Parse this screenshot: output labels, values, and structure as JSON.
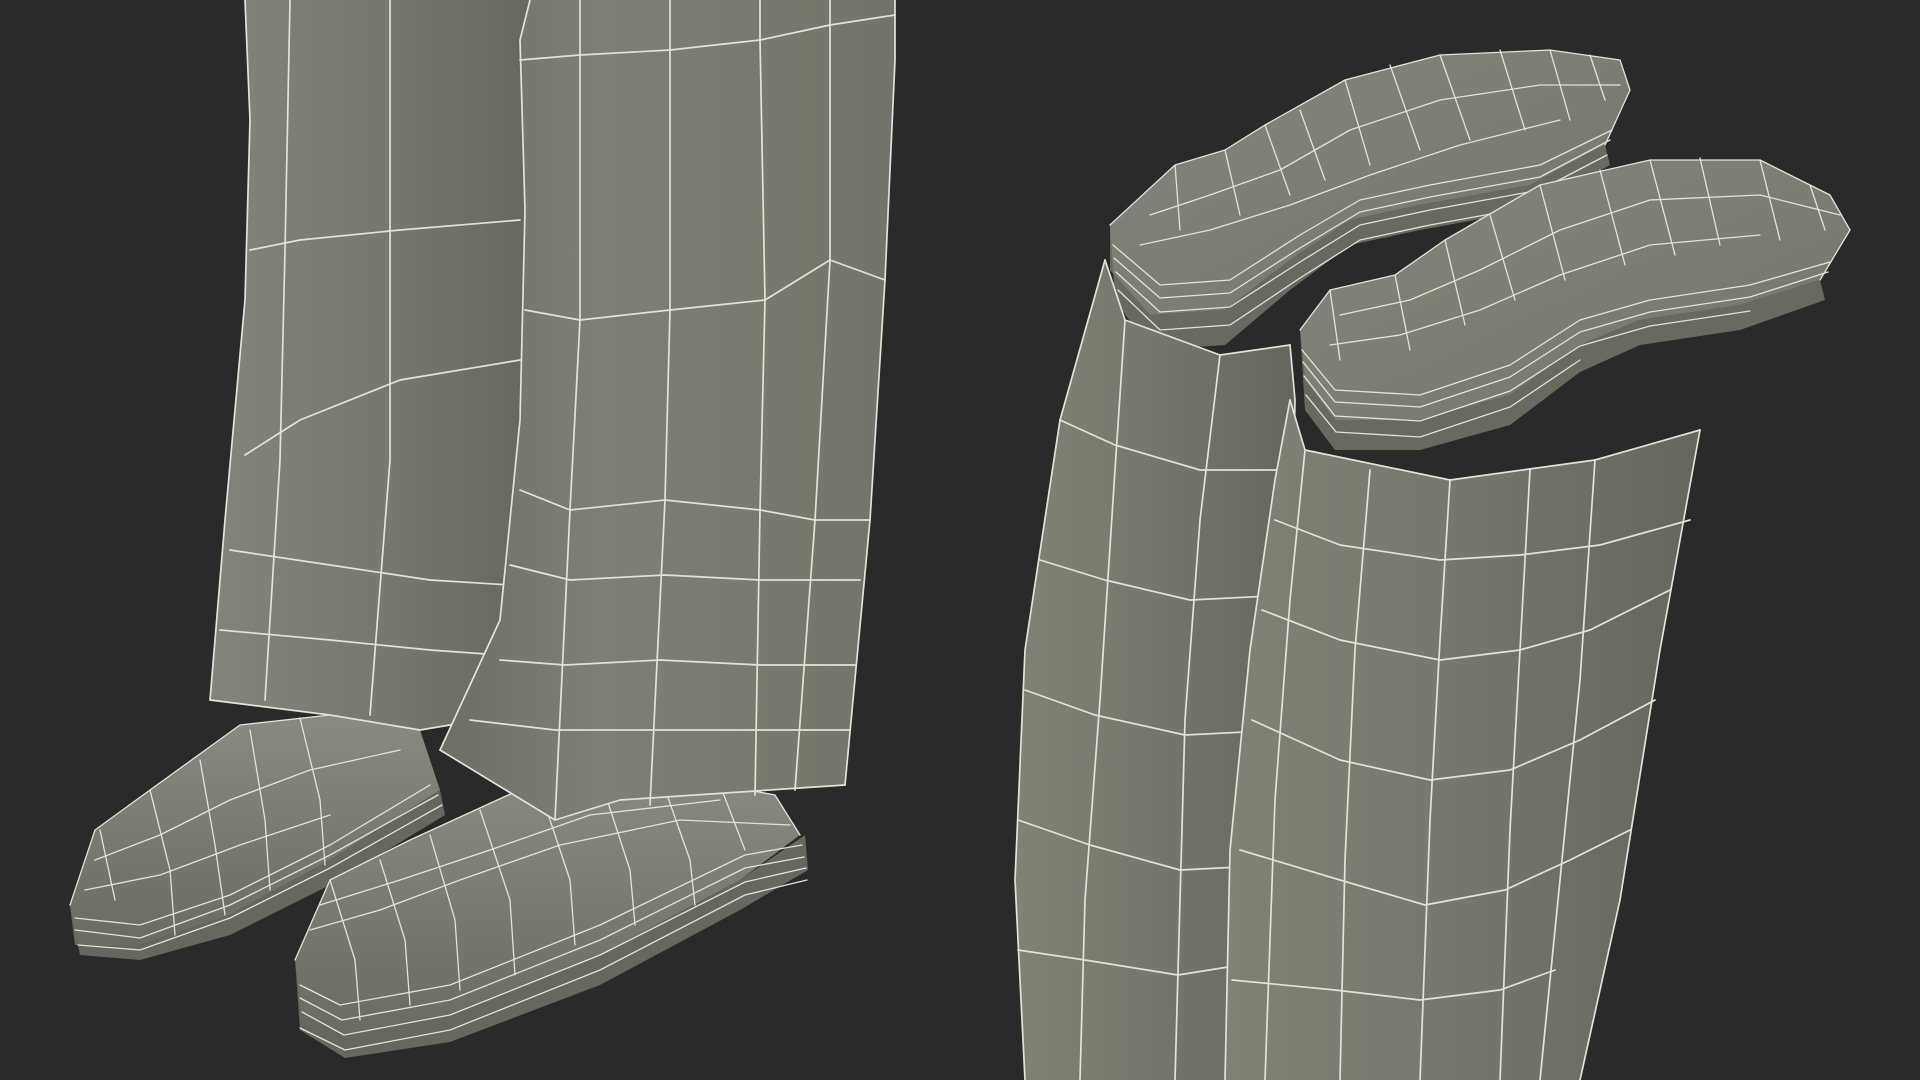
{
  "scene": {
    "background_color": "#2a2a2a",
    "mesh_color": "#797a6d",
    "mesh_light_color": "#8a8b7e",
    "mesh_shadow_color": "#5f6055",
    "wireframe_color": "#e4e2d8",
    "views": [
      "front-view",
      "underside-view"
    ]
  }
}
